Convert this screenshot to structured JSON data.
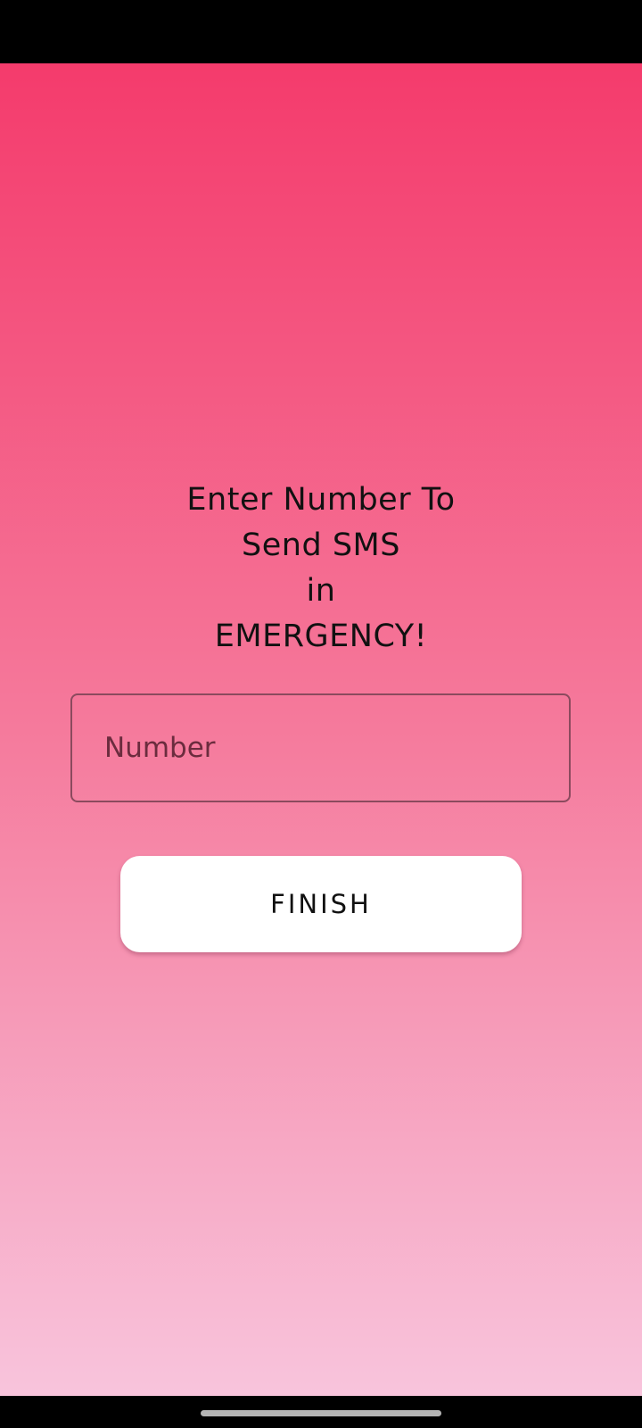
{
  "prompt": {
    "line1": "Enter Number To",
    "line2": "Send SMS",
    "line3": "in",
    "line4": "EMERGENCY!"
  },
  "number_field": {
    "placeholder": "Number",
    "value": ""
  },
  "finish_button": {
    "label": "FINISH"
  },
  "colors": {
    "gradient_top": "#f43b6c",
    "gradient_mid": "#f57a9c",
    "gradient_bottom": "#f8c4dc",
    "button_background": "#ffffff",
    "field_border": "#8b4a5e"
  },
  "icons": {
    "home_indicator": "home-indicator-bar"
  }
}
